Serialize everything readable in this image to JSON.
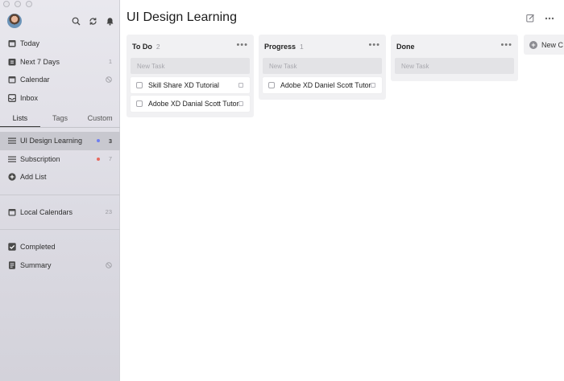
{
  "sidebar": {
    "smart_lists": [
      {
        "name": "today",
        "label": "Today",
        "count": "",
        "icon": "calendar-today-icon"
      },
      {
        "name": "next-7-days",
        "label": "Next 7 Days",
        "count": "1",
        "icon": "calendar-week-icon"
      },
      {
        "name": "calendar",
        "label": "Calendar",
        "count": "",
        "icon": "calendar-icon"
      },
      {
        "name": "inbox",
        "label": "Inbox",
        "count": "",
        "icon": "inbox-icon"
      }
    ],
    "tabs": [
      {
        "name": "lists",
        "label": "Lists"
      },
      {
        "name": "tags",
        "label": "Tags"
      },
      {
        "name": "custom",
        "label": "Custom"
      }
    ],
    "lists": [
      {
        "name": "ui-design-learning",
        "label": "UI Design Learning",
        "count": "3",
        "dot_color": "#6f7ff0"
      },
      {
        "name": "subscription",
        "label": "Subscription",
        "count": "7",
        "dot_color": "#e86a5f"
      }
    ],
    "add_list_label": "Add List",
    "local_calendars": {
      "label": "Local Calendars",
      "count": "23"
    },
    "completed_label": "Completed",
    "summary_label": "Summary"
  },
  "main": {
    "title": "UI Design Learning",
    "columns": [
      {
        "title": "To Do",
        "count": "2",
        "new_task_placeholder": "New Task",
        "tasks": [
          "Skill Share XD Tutorial",
          "Adobe XD Danial Scott Tutorial"
        ]
      },
      {
        "title": "Progress",
        "count": "1",
        "new_task_placeholder": "New Task",
        "tasks": [
          "Adobe XD Daniel Scott Tutorial"
        ]
      },
      {
        "title": "Done",
        "count": "",
        "new_task_placeholder": "New Task",
        "tasks": []
      }
    ],
    "new_column_label": "New C",
    "more_glyph": "•••"
  }
}
